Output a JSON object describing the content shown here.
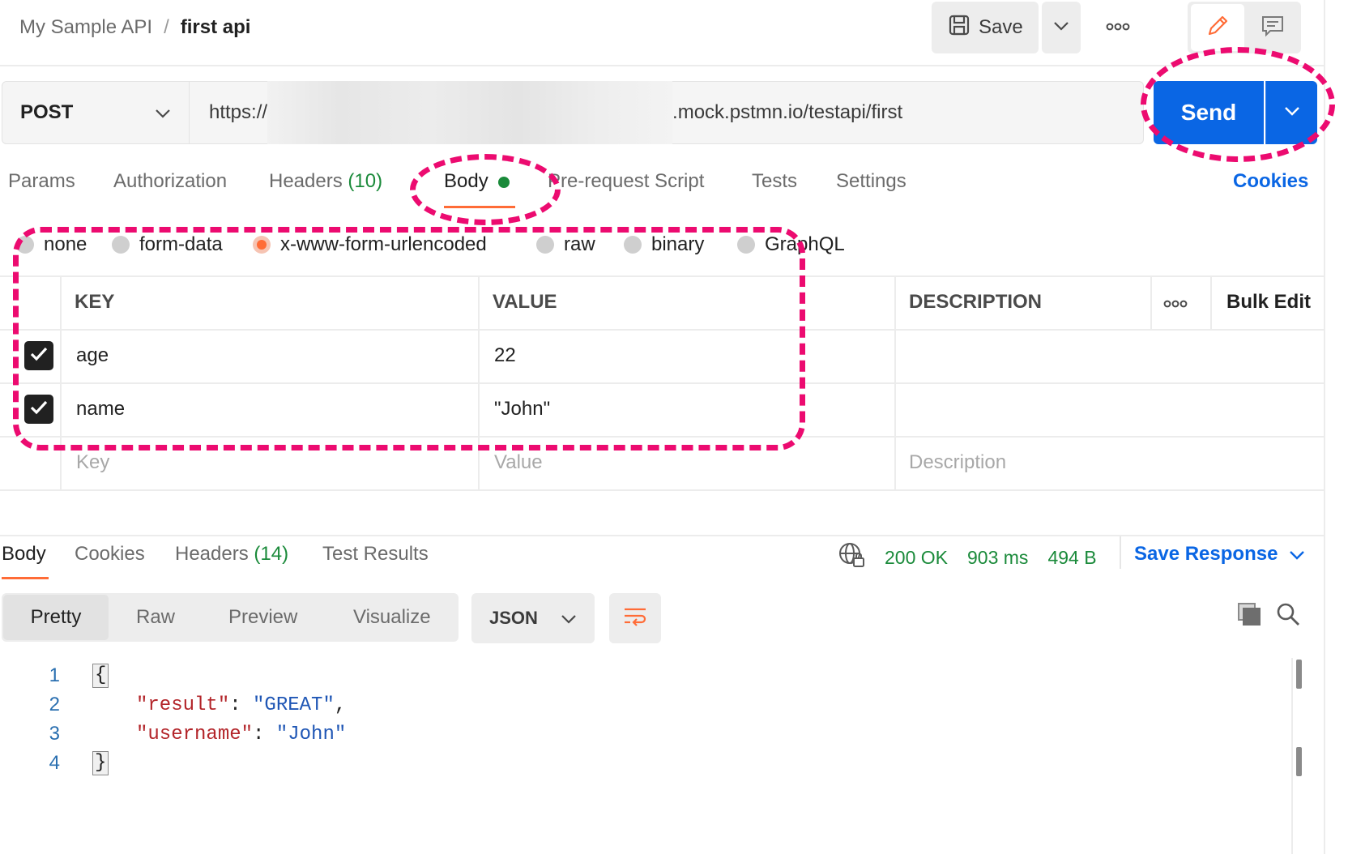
{
  "breadcrumb": {
    "parent": "My Sample API",
    "separator": "/",
    "current": "first api"
  },
  "toolbar": {
    "save_label": "Save"
  },
  "request": {
    "method": "POST",
    "url_prefix": "https://",
    "url_suffix": ".mock.pstmn.io/testapi/first",
    "send_label": "Send"
  },
  "request_tabs": {
    "params": "Params",
    "authorization": "Authorization",
    "headers": "Headers",
    "headers_count": "(10)",
    "body": "Body",
    "prerequest": "Pre-request Script",
    "tests": "Tests",
    "settings": "Settings",
    "cookies": "Cookies",
    "active": "Body"
  },
  "body_types": {
    "options": [
      "none",
      "form-data",
      "x-www-form-urlencoded",
      "raw",
      "binary",
      "GraphQL"
    ],
    "selected": "x-www-form-urlencoded"
  },
  "params_table": {
    "headers": {
      "key": "KEY",
      "value": "VALUE",
      "description": "DESCRIPTION",
      "bulk_edit": "Bulk Edit"
    },
    "rows": [
      {
        "checked": true,
        "key": "age",
        "value": "22",
        "description": ""
      },
      {
        "checked": true,
        "key": "name",
        "value": "\"John\"",
        "description": ""
      }
    ],
    "placeholders": {
      "key": "Key",
      "value": "Value",
      "description": "Description"
    }
  },
  "response": {
    "tabs": {
      "body": "Body",
      "cookies": "Cookies",
      "headers": "Headers",
      "headers_count": "(14)",
      "test_results": "Test Results",
      "active": "Body"
    },
    "status": "200 OK",
    "time": "903 ms",
    "size": "494 B",
    "save_response": "Save Response",
    "views": [
      "Pretty",
      "Raw",
      "Preview",
      "Visualize"
    ],
    "active_view": "Pretty",
    "format": "JSON",
    "code": {
      "line_numbers": [
        "1",
        "2",
        "3",
        "4"
      ],
      "open_brace": "{",
      "close_brace": "}",
      "fields": [
        {
          "key": "\"result\"",
          "value": "\"GREAT\"",
          "trail": ","
        },
        {
          "key": "\"username\"",
          "value": "\"John\"",
          "trail": ""
        }
      ],
      "colon": ": "
    }
  },
  "colors": {
    "accent": "#ff6c37",
    "primary": "#0a66e4",
    "success": "#1a8a3a",
    "annotation": "#ec0b70"
  },
  "icons": [
    "save-icon",
    "chevron-down-icon",
    "more-icon",
    "edit-icon",
    "comment-icon",
    "globe-lock-icon",
    "wrap-lines-icon",
    "copy-icon",
    "search-icon",
    "checkbox-checked-icon"
  ]
}
